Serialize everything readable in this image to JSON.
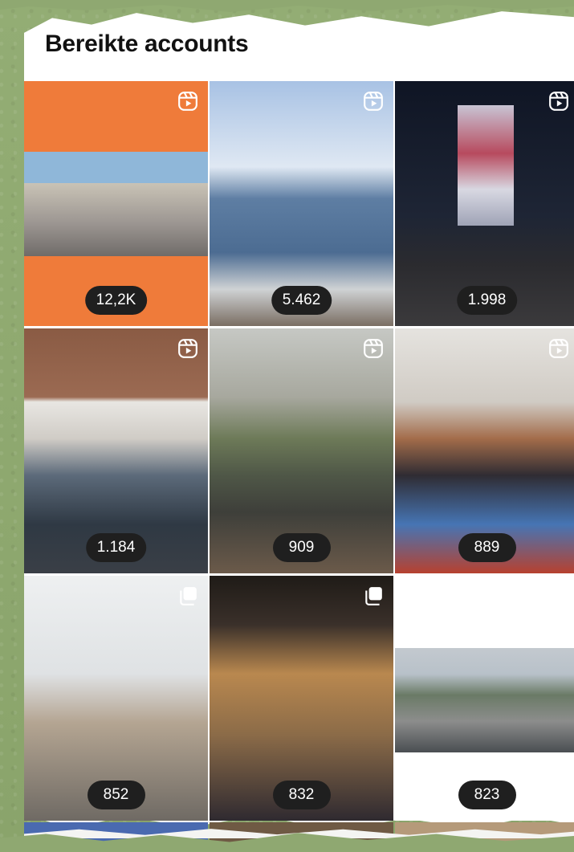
{
  "header": {
    "title": "Bereikte accounts"
  },
  "grid": {
    "tiles": [
      {
        "count": "12,2K",
        "type": "reel-icon"
      },
      {
        "count": "5.462",
        "type": "reel-icon"
      },
      {
        "count": "1.998",
        "type": "reel-icon"
      },
      {
        "count": "1.184",
        "type": "reel-icon"
      },
      {
        "count": "909",
        "type": "reel-icon"
      },
      {
        "count": "889",
        "type": "reel-icon"
      },
      {
        "count": "852",
        "type": "carousel-icon"
      },
      {
        "count": "832",
        "type": "carousel-icon"
      },
      {
        "count": "823",
        "type": "none"
      }
    ]
  },
  "colors": {
    "background": "#8fa871",
    "badge": "#1f1f1f",
    "badge_text": "#ffffff",
    "accent_orange": "#ef7b3a"
  }
}
